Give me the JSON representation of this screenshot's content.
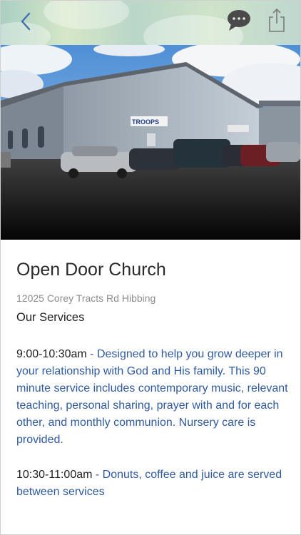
{
  "header": {
    "icons": {
      "back": "chevron-left-icon",
      "chat": "chat-bubble-icon",
      "share": "share-icon"
    },
    "colors": {
      "icon": "#3f6fae",
      "chat": "#4a4a4a"
    }
  },
  "hero": {
    "sign_text": "TROOPS"
  },
  "place": {
    "title": "Open Door Church",
    "address": "12025 Corey Tracts Rd Hibbing",
    "section_heading": "Our Services"
  },
  "services": [
    {
      "time": "9:00-10:30am",
      "description": " - Designed to help you grow deeper in your relationship with God and His family. This 90 minute service includes contemporary music, relevant teaching, personal sharing, prayer with and for each other, and monthly communion. Nursery care is provided."
    },
    {
      "time": "10:30-11:00am",
      "description": " - Donuts, coffee and juice are served between services"
    }
  ]
}
